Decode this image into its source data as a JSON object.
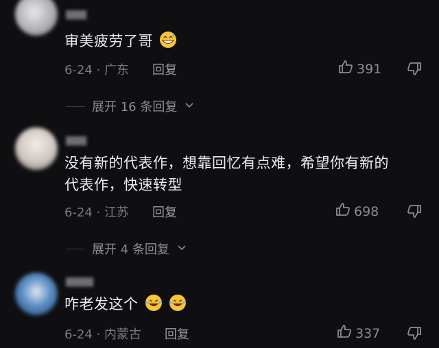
{
  "comments": [
    {
      "text": "审美疲劳了哥",
      "emoji": [
        "grin-sweat-emoji"
      ],
      "date_location": "6-24 · 广东",
      "reply_label": "回复",
      "likes": "391",
      "avatar_color": "#d9d9dc"
    },
    {
      "text_line1": "没有新的代表作，想靠回忆有点难，希望你有新的",
      "text_line2": "代表作，快速转型",
      "date_location": "6-24 · 江苏",
      "reply_label": "回复",
      "likes": "698",
      "avatar_color": "#e2d9d4"
    },
    {
      "text": "咋老发这个",
      "emoji": [
        "laughing-tears-emoji",
        "laughing-tears-emoji"
      ],
      "date_location": "6-24 · 内蒙古",
      "reply_label": "回复",
      "likes": "337",
      "avatar_color": "#3b6ea5"
    }
  ],
  "expands": [
    {
      "label": "展开 16 条回复"
    },
    {
      "label": "展开 4 条回复"
    }
  ]
}
